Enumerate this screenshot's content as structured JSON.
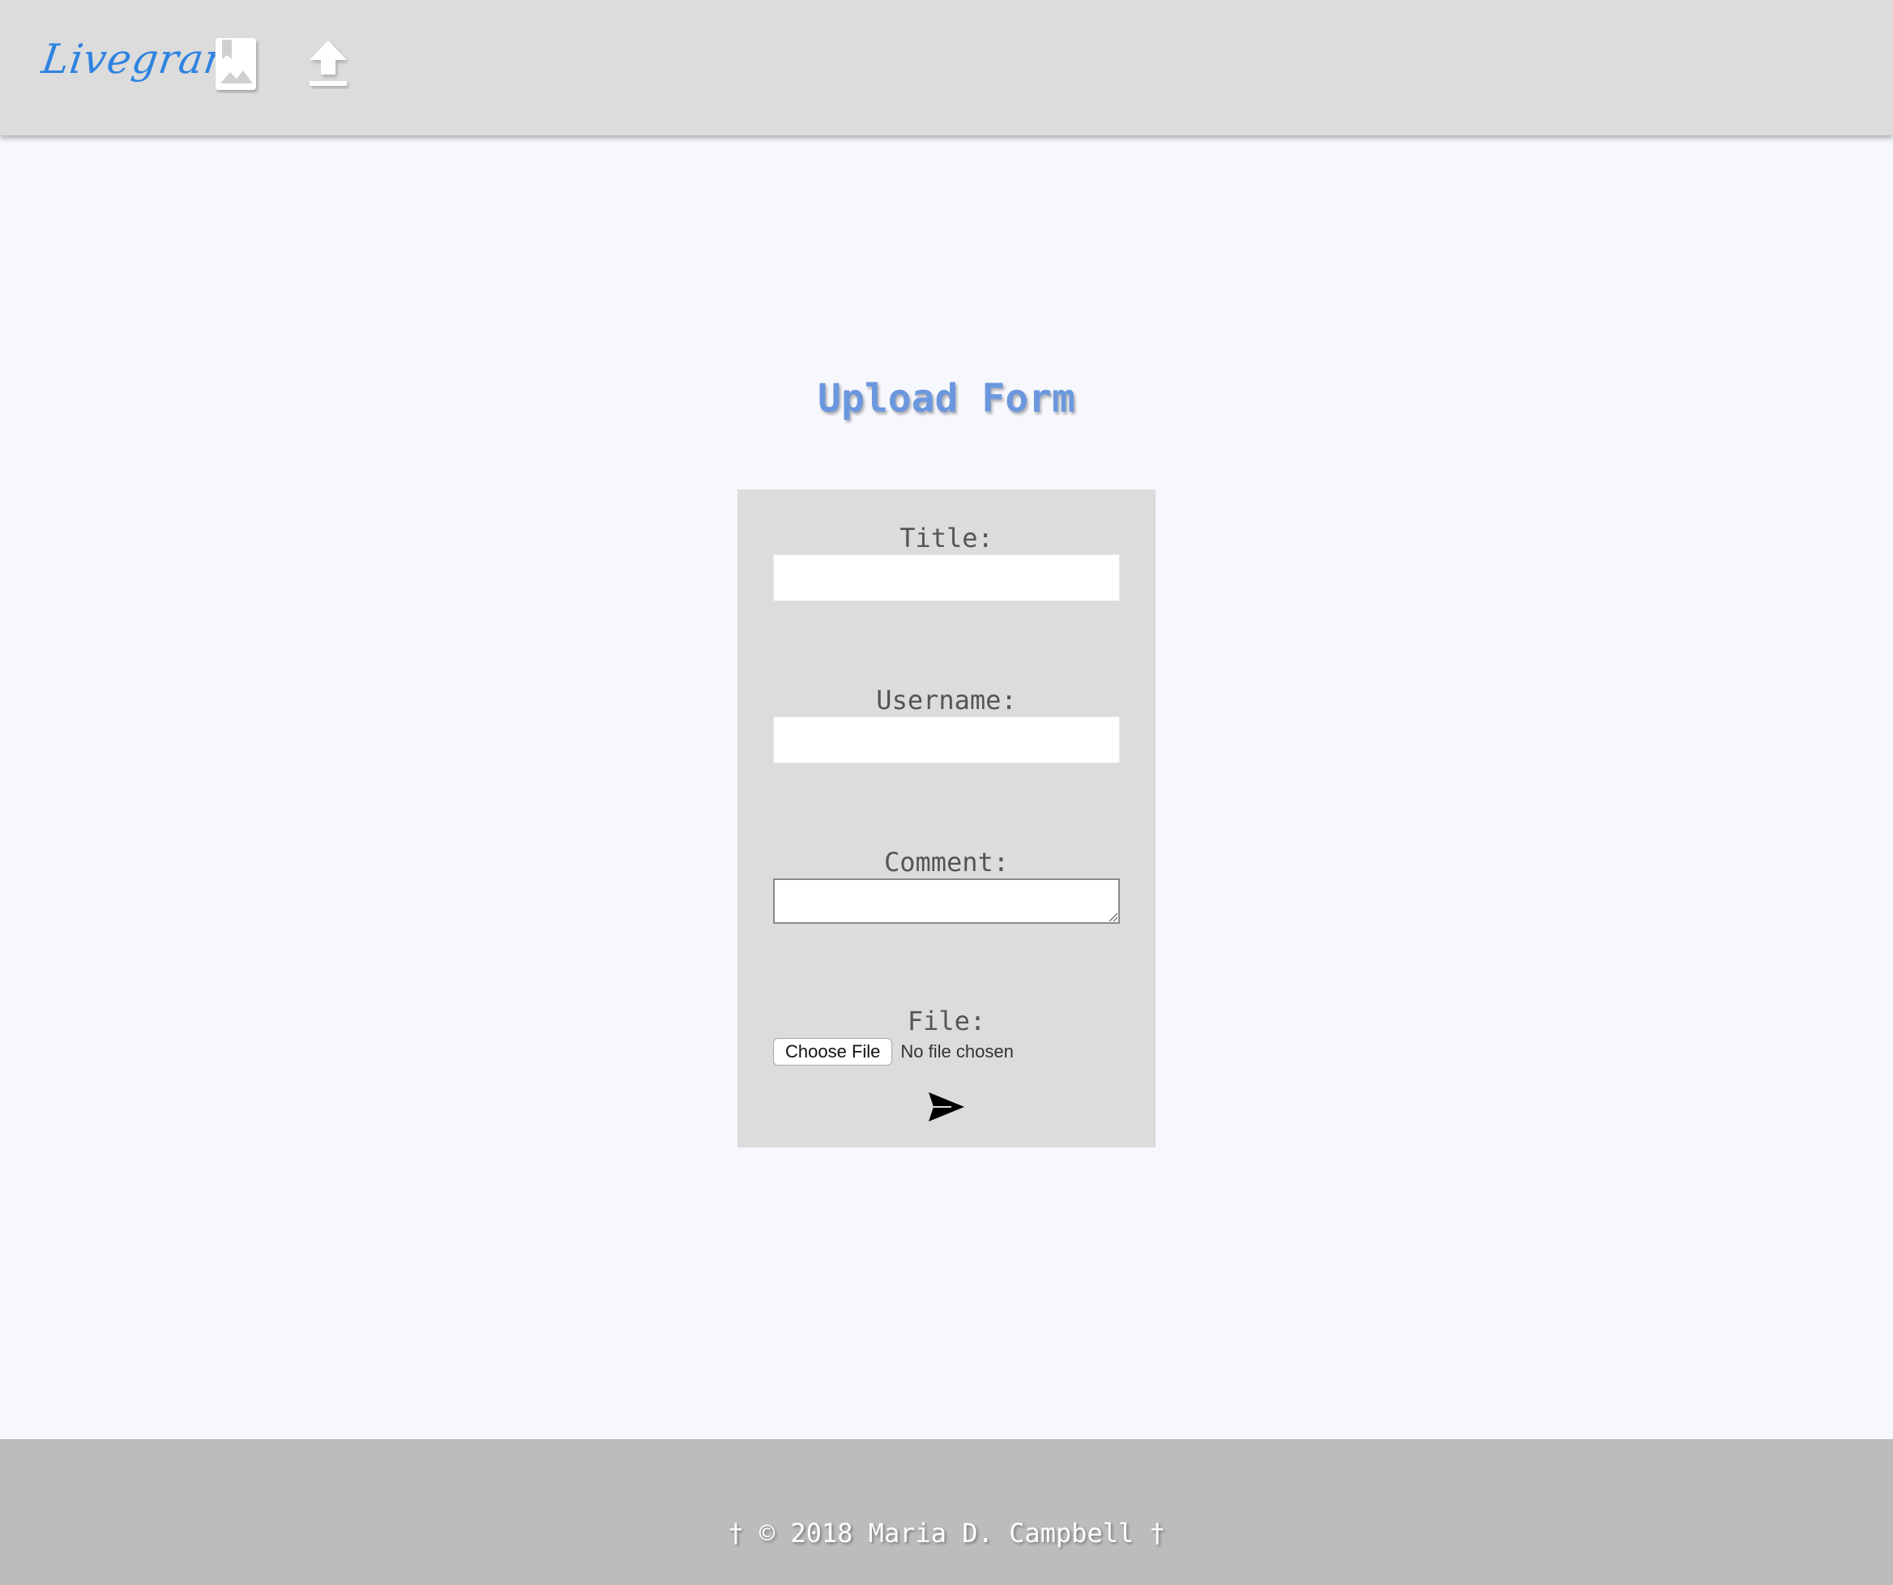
{
  "header": {
    "brand": "Livegram",
    "nav": [
      {
        "icon": "gallery-icon"
      },
      {
        "icon": "upload-icon"
      }
    ]
  },
  "main": {
    "title": "Upload Form"
  },
  "form": {
    "title_label": "Title:",
    "title_value": "",
    "username_label": "Username:",
    "username_value": "",
    "comment_label": "Comment:",
    "comment_value": "",
    "file_label": "File:",
    "choose_file_label": "Choose File",
    "file_status": "No file chosen",
    "submit_icon": "send-icon"
  },
  "footer": {
    "text": "† © 2018 Maria D. Campbell †"
  },
  "colors": {
    "header_bg": "#dcdcdc",
    "brand": "#2f83e0",
    "title": "#6b97de",
    "page_bg": "#f7f8fd",
    "card_bg": "#dcdcdc",
    "footer_bg": "#bcbcbc"
  }
}
